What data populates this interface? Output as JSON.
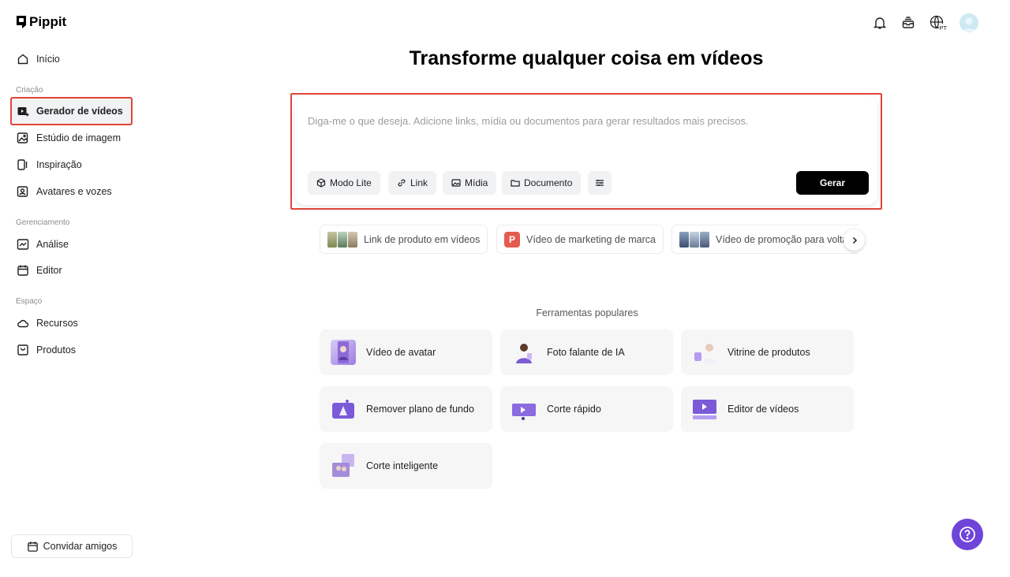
{
  "app": {
    "name": "Pippit"
  },
  "sidebar": {
    "home": "Início",
    "sections": {
      "creation": "Criação",
      "management": "Gerenciamento",
      "space": "Espaço"
    },
    "items": [
      {
        "label": "Gerador de vídeos",
        "icon": "video-generator-icon",
        "active": true
      },
      {
        "label": "Estúdio de imagem",
        "icon": "image-studio-icon"
      },
      {
        "label": "Inspiração",
        "icon": "inspiration-icon"
      },
      {
        "label": "Avatares e vozes",
        "icon": "avatar-voice-icon"
      },
      {
        "label": "Análise",
        "icon": "analytics-icon"
      },
      {
        "label": "Editor",
        "icon": "calendar-icon"
      },
      {
        "label": "Recursos",
        "icon": "cloud-icon"
      },
      {
        "label": "Produtos",
        "icon": "product-icon"
      }
    ],
    "invite": "Convidar amigos"
  },
  "topbar": {
    "language": "PT"
  },
  "main": {
    "title": "Transforme qualquer coisa em vídeos",
    "prompt": {
      "placeholder": "Diga-me o que deseja. Adicione links, mídia ou documentos para gerar resultados mais precisos.",
      "buttons": [
        "Modo Lite",
        "Link",
        "Mídia",
        "Documento"
      ],
      "generate": "Gerar"
    },
    "suggestions": [
      "Link de produto em vídeos",
      "Vídeo de marketing de marca",
      "Vídeo de promoção para volta"
    ],
    "suggestion_badge": "P",
    "tools_title": "Ferramentas populares",
    "tools": [
      "Vídeo de avatar",
      "Foto falante de IA",
      "Vitrine de produtos",
      "Remover plano de fundo",
      "Corte rápido",
      "Editor de vídeos",
      "Corte inteligente"
    ]
  },
  "colors": {
    "accent": "#6e44d9",
    "highlight_border": "#e0453a",
    "primary_button": "#000000"
  }
}
